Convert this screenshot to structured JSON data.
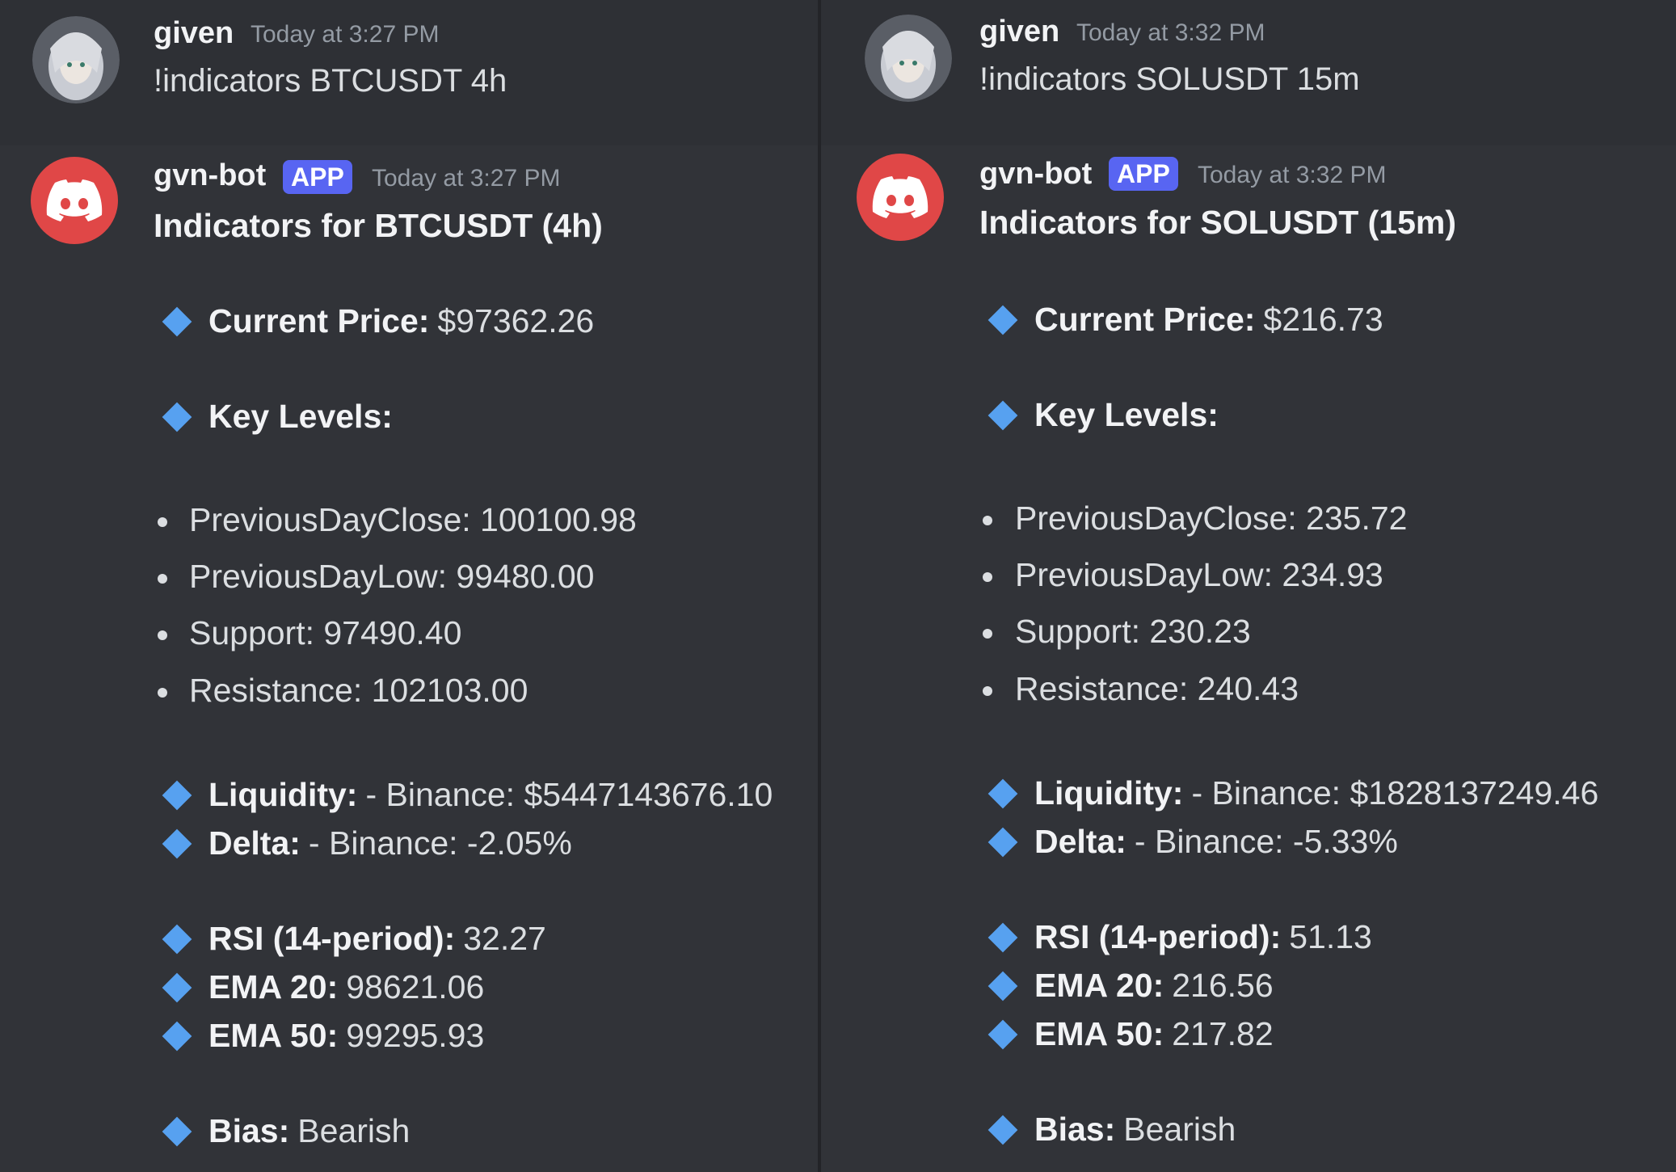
{
  "left": {
    "user": {
      "name": "given",
      "timestamp": "Today at 3:27 PM",
      "command": "!indicators BTCUSDT 4h"
    },
    "bot": {
      "name": "gvn-bot",
      "badge": "APP",
      "timestamp": "Today at 3:27 PM",
      "title": "Indicators for BTCUSDT (4h)",
      "current_price_label": "Current Price:",
      "current_price": "$97362.26",
      "key_levels_label": "Key Levels:",
      "levels": [
        "PreviousDayClose: 100100.98",
        "PreviousDayLow: 99480.00",
        "Support: 97490.40",
        "Resistance: 102103.00"
      ],
      "liquidity_label": "Liquidity:",
      "liquidity": "- Binance: $5447143676.10",
      "delta_label": "Delta:",
      "delta": "- Binance: -2.05%",
      "rsi_label": "RSI (14-period):",
      "rsi": "32.27",
      "ema20_label": "EMA 20:",
      "ema20": "98621.06",
      "ema50_label": "EMA 50:",
      "ema50": "99295.93",
      "bias_label": "Bias:",
      "bias": "Bearish"
    }
  },
  "right": {
    "user": {
      "name": "given",
      "timestamp": "Today at 3:32 PM",
      "command": "!indicators SOLUSDT 15m"
    },
    "bot": {
      "name": "gvn-bot",
      "badge": "APP",
      "timestamp": "Today at 3:32 PM",
      "title": "Indicators for SOLUSDT (15m)",
      "current_price_label": "Current Price:",
      "current_price": "$216.73",
      "key_levels_label": "Key Levels:",
      "levels": [
        "PreviousDayClose: 235.72",
        "PreviousDayLow: 234.93",
        "Support: 230.23",
        "Resistance: 240.43"
      ],
      "liquidity_label": "Liquidity:",
      "liquidity": "- Binance: $1828137249.46",
      "delta_label": "Delta:",
      "delta": "- Binance: -5.33%",
      "rsi_label": "RSI (14-period):",
      "rsi": "51.13",
      "ema20_label": "EMA 20:",
      "ema20": "216.56",
      "ema50_label": "EMA 50:",
      "ema50": "217.82",
      "bias_label": "Bias:",
      "bias": "Bearish"
    }
  },
  "colors": {
    "background": "#313338",
    "accent_diamond": "#57a1f0",
    "bot_avatar": "#e04747",
    "badge": "#5865f2"
  }
}
